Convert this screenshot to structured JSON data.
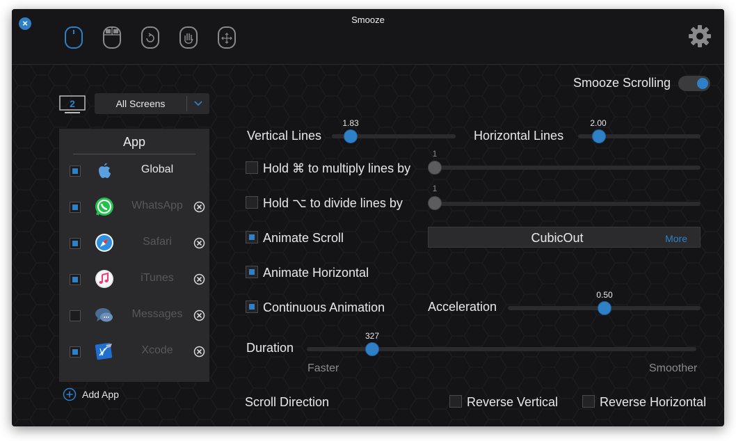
{
  "window": {
    "title": "Smooze"
  },
  "toolbar": {
    "tools": [
      {
        "icon": "mouse-scroll-icon"
      },
      {
        "icon": "mouse-buttons-icon"
      },
      {
        "icon": "mouse-gesture-icon"
      },
      {
        "icon": "hand-grab-icon"
      },
      {
        "icon": "mouse-move-icon"
      }
    ],
    "settings_icon": "gear-icon"
  },
  "screens": {
    "number": "2",
    "selected": "All Screens"
  },
  "apps": {
    "header": "App",
    "items": [
      {
        "name": "Global",
        "checked": true,
        "enabled": true
      },
      {
        "name": "WhatsApp",
        "checked": true,
        "enabled": false
      },
      {
        "name": "Safari",
        "checked": true,
        "enabled": false
      },
      {
        "name": "iTunes",
        "checked": true,
        "enabled": false
      },
      {
        "name": "Messages",
        "checked": false,
        "enabled": false
      },
      {
        "name": "Xcode",
        "checked": true,
        "enabled": false
      }
    ],
    "add_label": "Add App"
  },
  "smooze_scrolling": {
    "label": "Smooze Scrolling",
    "on": true
  },
  "vertical_lines": {
    "label": "Vertical Lines",
    "value": "1.83"
  },
  "horizontal_lines": {
    "label": "Horizontal Lines",
    "value": "2.00"
  },
  "hold_cmd": {
    "label": "Hold ⌘ to multiply lines by",
    "value": "1",
    "checked": false
  },
  "hold_opt": {
    "label": "Hold ⌥ to divide lines by",
    "value": "1",
    "checked": false
  },
  "animate_scroll": {
    "label": "Animate Scroll",
    "checked": true
  },
  "easing": {
    "value": "CubicOut",
    "more_label": "More"
  },
  "animate_horizontal": {
    "label": "Animate Horizontal",
    "checked": true
  },
  "continuous_animation": {
    "label": "Continuous Animation",
    "checked": true
  },
  "acceleration": {
    "label": "Acceleration",
    "value": "0.50"
  },
  "duration": {
    "label": "Duration",
    "value": "327",
    "min_label": "Faster",
    "max_label": "Smoother"
  },
  "scroll_direction": {
    "label": "Scroll Direction",
    "reverse_vertical": {
      "label": "Reverse Vertical",
      "checked": false
    },
    "reverse_horizontal": {
      "label": "Reverse Horizontal",
      "checked": false
    }
  },
  "colors": {
    "accent": "#2f80c6",
    "background": "#141416",
    "panel": "#2a2a2c"
  }
}
